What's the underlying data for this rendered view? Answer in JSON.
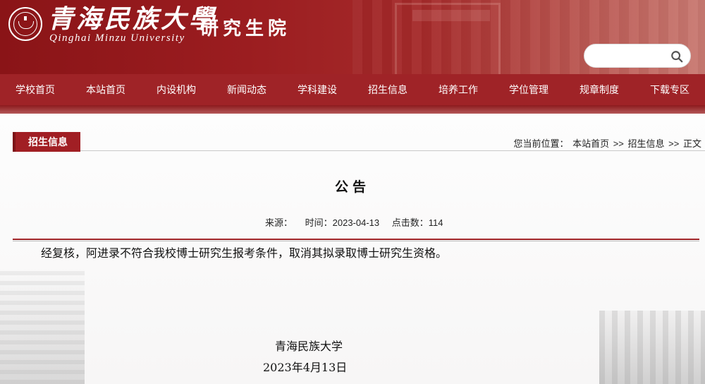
{
  "header": {
    "logo_cn": "青海民族大學",
    "logo_en": "Qinghai Minzu University",
    "subtitle": "研究生院",
    "search": {
      "placeholder": "",
      "value": ""
    }
  },
  "nav": {
    "items": [
      "学校首页",
      "本站首页",
      "内设机构",
      "新闻动态",
      "学科建设",
      "招生信息",
      "培养工作",
      "学位管理",
      "规章制度",
      "下载专区"
    ]
  },
  "section": {
    "category": "招生信息",
    "breadcrumb": {
      "label": "您当前位置：",
      "path": [
        "本站首页",
        ">>",
        "招生信息",
        ">>",
        "正文"
      ]
    }
  },
  "article": {
    "title": "公告",
    "meta": {
      "source": "来源：",
      "time": "时间：2023-04-13",
      "clicks": "点击数：114"
    },
    "body": "经复核，阿进录不符合我校博士研究生报考条件，取消其拟录取博士研究生资格。",
    "signature_org": "青海民族大学",
    "signature_date": "2023年4月13日"
  },
  "colors": {
    "brand_red": "#9f2327",
    "tab_red": "#a11f24"
  },
  "icons": {
    "search": "search-icon",
    "emblem": "university-emblem-icon"
  }
}
